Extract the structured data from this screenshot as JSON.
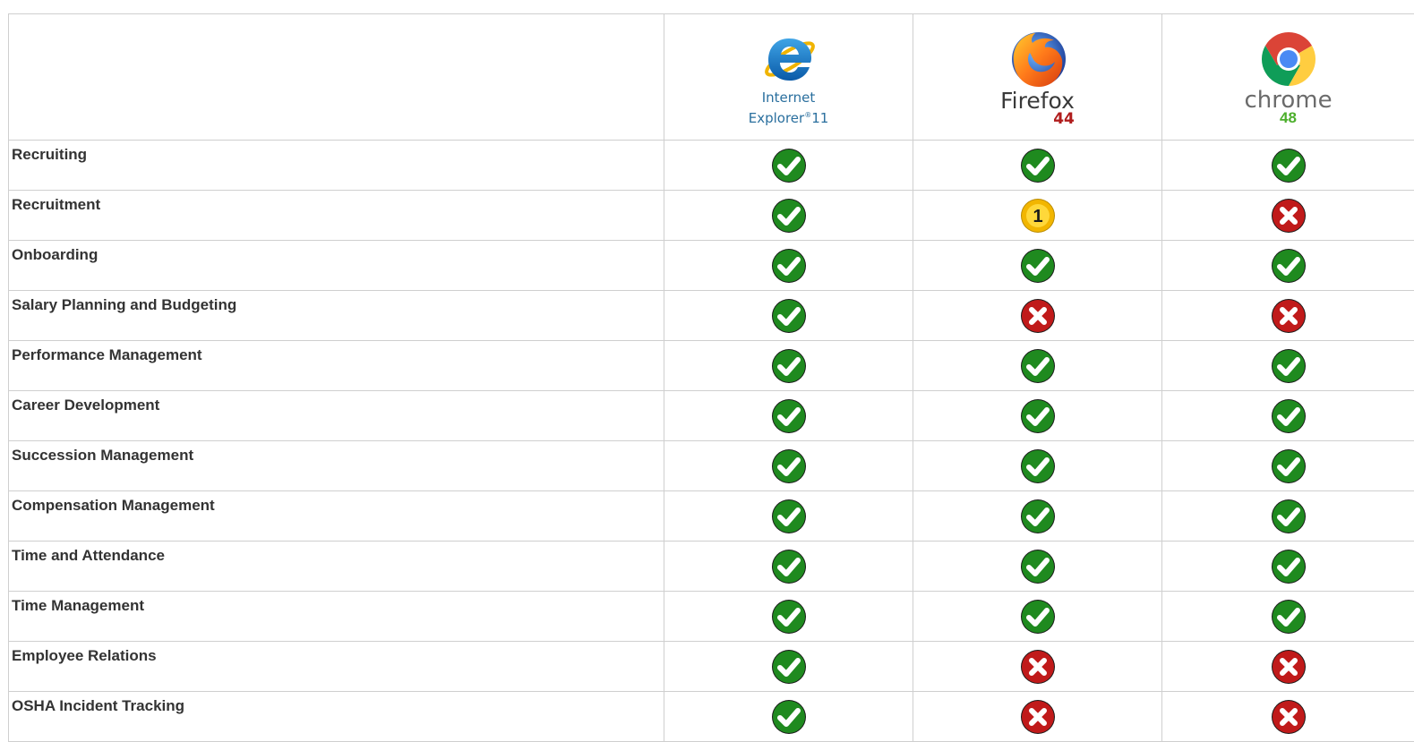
{
  "browsers": [
    {
      "key": "ie",
      "name": "Internet",
      "name2": "Explorer",
      "version": "11",
      "icon": "internet-explorer-logo"
    },
    {
      "key": "firefox",
      "name": "Firefox",
      "version": "44",
      "icon": "firefox-logo"
    },
    {
      "key": "chrome",
      "name": "chrome",
      "version": "48",
      "icon": "chrome-logo"
    }
  ],
  "rows": [
    {
      "feature": "Recruiting",
      "ie": "check",
      "firefox": "check",
      "chrome": "check"
    },
    {
      "feature": "Recruitment",
      "ie": "check",
      "firefox": "note",
      "chrome": "cross"
    },
    {
      "feature": "Onboarding",
      "ie": "check",
      "firefox": "check",
      "chrome": "check"
    },
    {
      "feature": "Salary Planning and Budgeting",
      "ie": "check",
      "firefox": "cross",
      "chrome": "cross"
    },
    {
      "feature": "Performance Management",
      "ie": "check",
      "firefox": "check",
      "chrome": "check"
    },
    {
      "feature": "Career Development",
      "ie": "check",
      "firefox": "check",
      "chrome": "check"
    },
    {
      "feature": "Succession Management",
      "ie": "check",
      "firefox": "check",
      "chrome": "check"
    },
    {
      "feature": "Compensation Management",
      "ie": "check",
      "firefox": "check",
      "chrome": "check"
    },
    {
      "feature": "Time and Attendance",
      "ie": "check",
      "firefox": "check",
      "chrome": "check"
    },
    {
      "feature": "Time Management",
      "ie": "check",
      "firefox": "check",
      "chrome": "check"
    },
    {
      "feature": "Employee Relations",
      "ie": "check",
      "firefox": "cross",
      "chrome": "cross"
    },
    {
      "feature": "OSHA Incident Tracking",
      "ie": "check",
      "firefox": "cross",
      "chrome": "cross"
    }
  ],
  "note_label": "1",
  "colors": {
    "check": "#1f8a1f",
    "cross": "#c01a1a",
    "note": "#f2b600",
    "border": "#cfcfcf",
    "feature_text": "#333333"
  }
}
